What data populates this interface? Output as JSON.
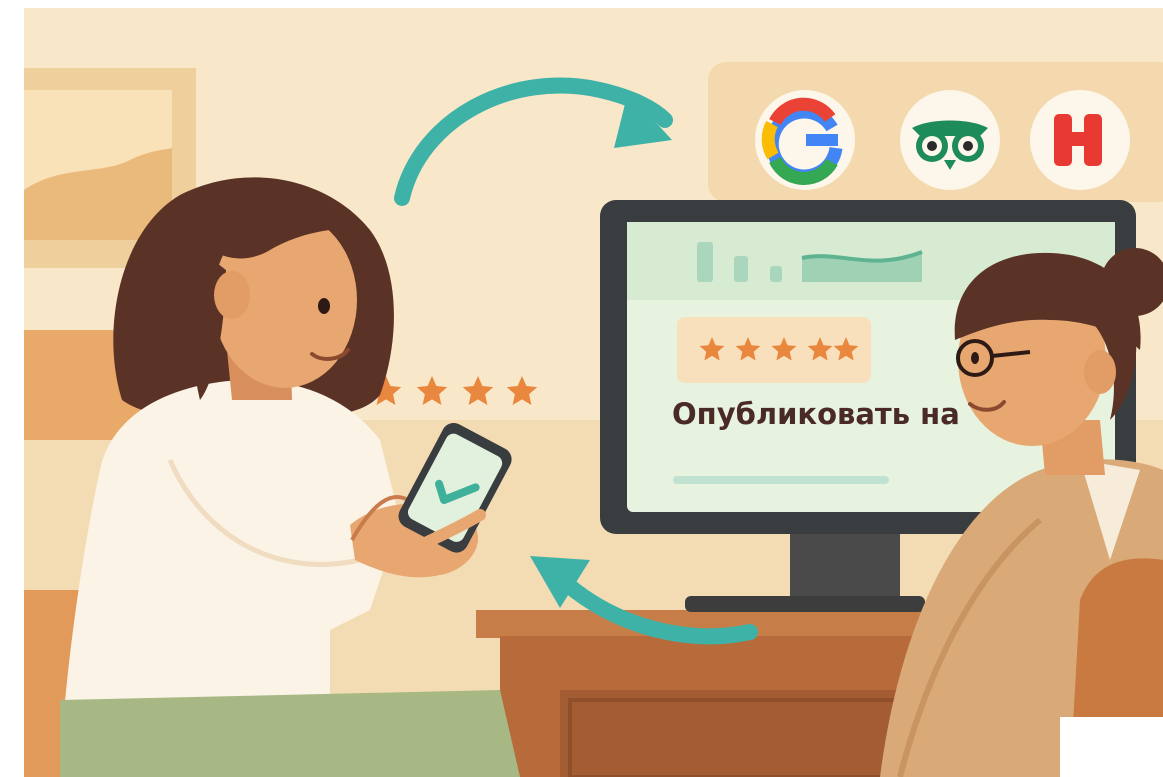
{
  "monitor": {
    "publish_text": "Опубликовать на",
    "rating_stars": 5
  },
  "floating_rating": {
    "stars": 4
  },
  "platforms": [
    {
      "icon": "google-icon"
    },
    {
      "icon": "tripadvisor-owl-icon"
    },
    {
      "icon": "hotels-h-icon"
    }
  ],
  "colors": {
    "background": "#f7e6c7",
    "star": "#e8873d",
    "arrow": "#3fb2a8",
    "monitor_screen": "#e2f1de",
    "check": "#3fb09a"
  }
}
